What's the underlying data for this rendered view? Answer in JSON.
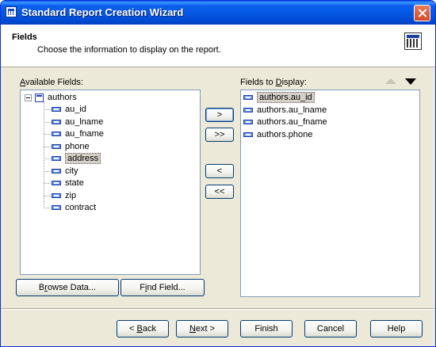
{
  "window": {
    "title": "Standard Report Creation Wizard"
  },
  "header": {
    "title": "Fields",
    "subtitle": "Choose the information to display on the report."
  },
  "available": {
    "label_pre": "",
    "label_u": "A",
    "label_post": "vailable Fields:",
    "table": "authors",
    "fields": [
      "au_id",
      "au_lname",
      "au_fname",
      "phone",
      "address",
      "city",
      "state",
      "zip",
      "contract"
    ],
    "selected": "address"
  },
  "display": {
    "label_pre": "Fields to ",
    "label_u": "D",
    "label_post": "isplay:",
    "fields": [
      "authors.au_id",
      "authors.au_lname",
      "authors.au_fname",
      "authors.phone"
    ],
    "selected": "authors.au_id"
  },
  "move_buttons": {
    "add": ">",
    "add_all": ">>",
    "remove": "<",
    "remove_all": "<<"
  },
  "left_buttons": {
    "browse_pre": "B",
    "browse_u": "r",
    "browse_post": "owse Data...",
    "find_pre": "F",
    "find_u": "i",
    "find_post": "nd Field..."
  },
  "footer": {
    "back_pre": "< ",
    "back_u": "B",
    "back_post": "ack",
    "next_pre": "",
    "next_u": "N",
    "next_post": "ext >",
    "finish": "Finish",
    "cancel": "Cancel",
    "help": "Help"
  }
}
